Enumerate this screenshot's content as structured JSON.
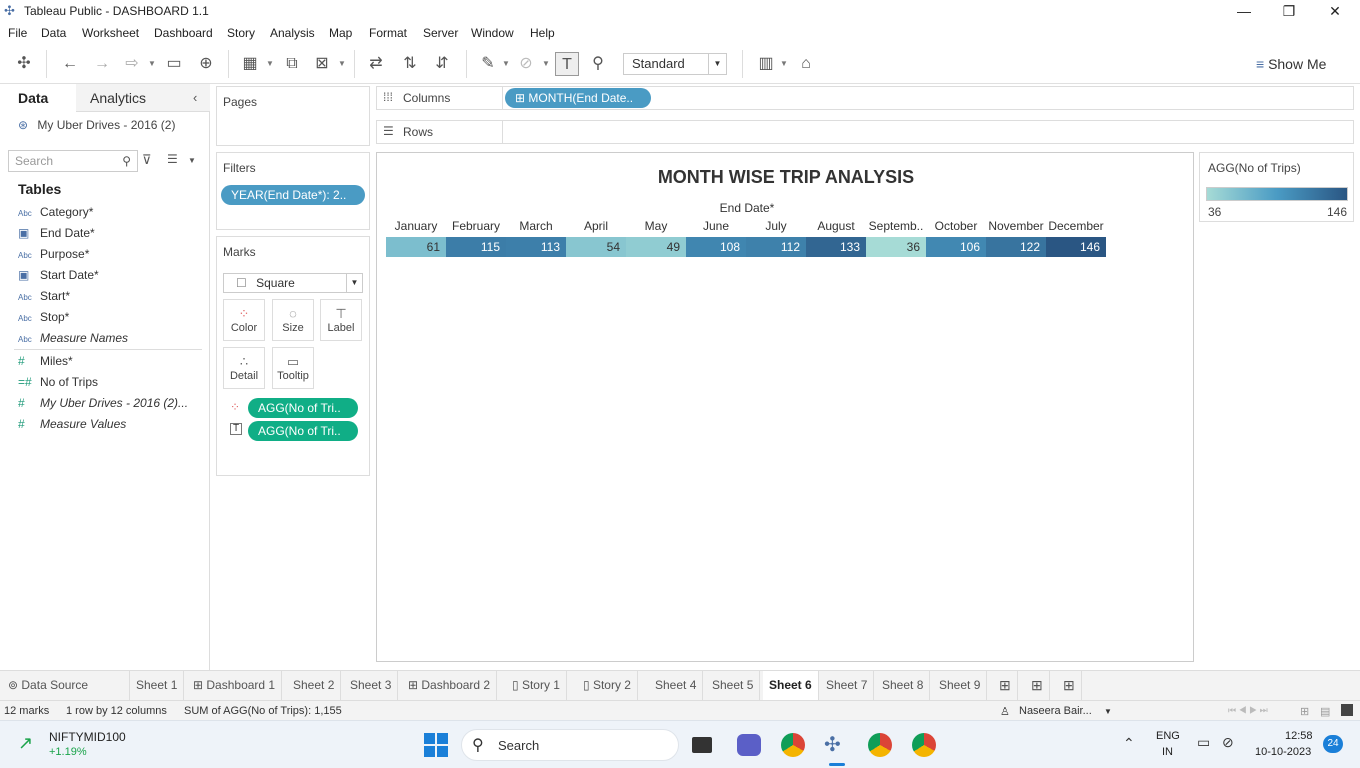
{
  "window": {
    "title": "Tableau Public - DASHBOARD 1.1",
    "minimize": "—",
    "maximize": "❐",
    "close": "✕"
  },
  "menu": [
    "File",
    "Data",
    "Worksheet",
    "Dashboard",
    "Story",
    "Analysis",
    "Map",
    "Format",
    "Server",
    "Window",
    "Help"
  ],
  "toolbar": {
    "fit_mode": "Standard",
    "show_me": "Show Me"
  },
  "data_pane": {
    "tabs": [
      "Data",
      "Analytics"
    ],
    "datasource": "My Uber Drives - 2016 (2)",
    "search_placeholder": "Search",
    "tables_heading": "Tables",
    "fields": [
      {
        "type": "Abc",
        "name": "Category*"
      },
      {
        "type": "date",
        "name": "End Date*"
      },
      {
        "type": "Abc",
        "name": "Purpose*"
      },
      {
        "type": "date",
        "name": "Start Date*"
      },
      {
        "type": "Abc",
        "name": "Start*"
      },
      {
        "type": "Abc",
        "name": "Stop*"
      },
      {
        "type": "Abc",
        "name": "Measure Names"
      },
      {
        "type": "#",
        "name": "Miles*"
      },
      {
        "type": "calc",
        "name": "No of Trips"
      },
      {
        "type": "#",
        "name": "My Uber Drives - 2016 (2)..."
      },
      {
        "type": "#",
        "name": "Measure Values"
      }
    ]
  },
  "pages": {
    "title": "Pages"
  },
  "filters": {
    "title": "Filters",
    "pill": "YEAR(End Date*): 2.."
  },
  "marks": {
    "title": "Marks",
    "type": "Square",
    "buttons": [
      "Color",
      "Size",
      "Label",
      "Detail",
      "Tooltip"
    ],
    "pills": [
      "AGG(No of Tri..",
      "AGG(No of Tri.."
    ]
  },
  "shelves": {
    "columns_label": "Columns",
    "columns_pill": "MONTH(End Date..",
    "rows_label": "Rows"
  },
  "chart_data": {
    "type": "heatmap",
    "title": "MONTH WISE TRIP ANALYSIS",
    "header": "End Date*",
    "categories": [
      "January",
      "February",
      "March",
      "April",
      "May",
      "June",
      "July",
      "August",
      "Septemb..",
      "October",
      "November",
      "December"
    ],
    "values": [
      61,
      115,
      113,
      54,
      49,
      108,
      112,
      133,
      36,
      106,
      122,
      146
    ],
    "color_range": [
      36,
      146
    ],
    "colors": {
      "low": "#a6dbd6",
      "mid": "#4a9bc4",
      "high": "#2a5683"
    }
  },
  "legend": {
    "title": "AGG(No of Trips)",
    "min": "36",
    "max": "146"
  },
  "sheet_tabs": [
    "Data Source",
    "Sheet 1",
    "Dashboard 1",
    "Sheet 2",
    "Sheet 3",
    "Dashboard 2",
    "Story 1",
    "Story 2",
    "Sheet 4",
    "Sheet 5",
    "Sheet 6",
    "Sheet 7",
    "Sheet 8",
    "Sheet 9"
  ],
  "active_tab": "Sheet 6",
  "status": {
    "marks": "12 marks",
    "dims": "1 row by 12 columns",
    "sum": "SUM of AGG(No of Trips): 1,155",
    "user": "Naseera Bair..."
  },
  "taskbar": {
    "stock_name": "NIFTYMID100",
    "stock_change": "+1.19%",
    "search": "Search",
    "lang1": "ENG",
    "lang2": "IN",
    "time": "12:58",
    "date": "10-10-2023",
    "badge": "24"
  }
}
